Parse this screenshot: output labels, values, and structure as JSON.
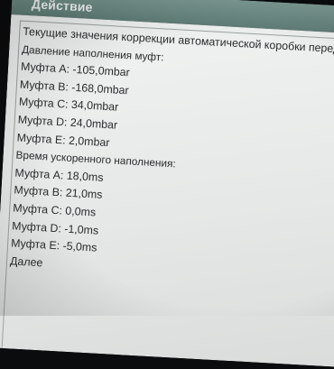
{
  "window": {
    "title": "Действие"
  },
  "info": {
    "line_intro": "Текущие значения коррекции автоматической коробки переда",
    "pressure_header": "Давление наполнения муфт:",
    "pressure": [
      {
        "text": "Муфта A: -105,0mbar"
      },
      {
        "text": "Муфта B: -168,0mbar"
      },
      {
        "text": "Муфта C: 34,0mbar"
      },
      {
        "text": "Муфта D: 24,0mbar"
      },
      {
        "text": "Муфта E: 2,0mbar"
      }
    ],
    "fill_time_header": "Время ускоренного наполнения:",
    "fill_time": [
      {
        "text": "Муфта A: 18,0ms"
      },
      {
        "text": "Муфта B: 21,0ms"
      },
      {
        "text": "Муфта C: 0,0ms"
      },
      {
        "text": "Муфта D: -1,0ms"
      },
      {
        "text": "Муфта E: -5,0ms"
      }
    ],
    "next_label": "Далее"
  }
}
